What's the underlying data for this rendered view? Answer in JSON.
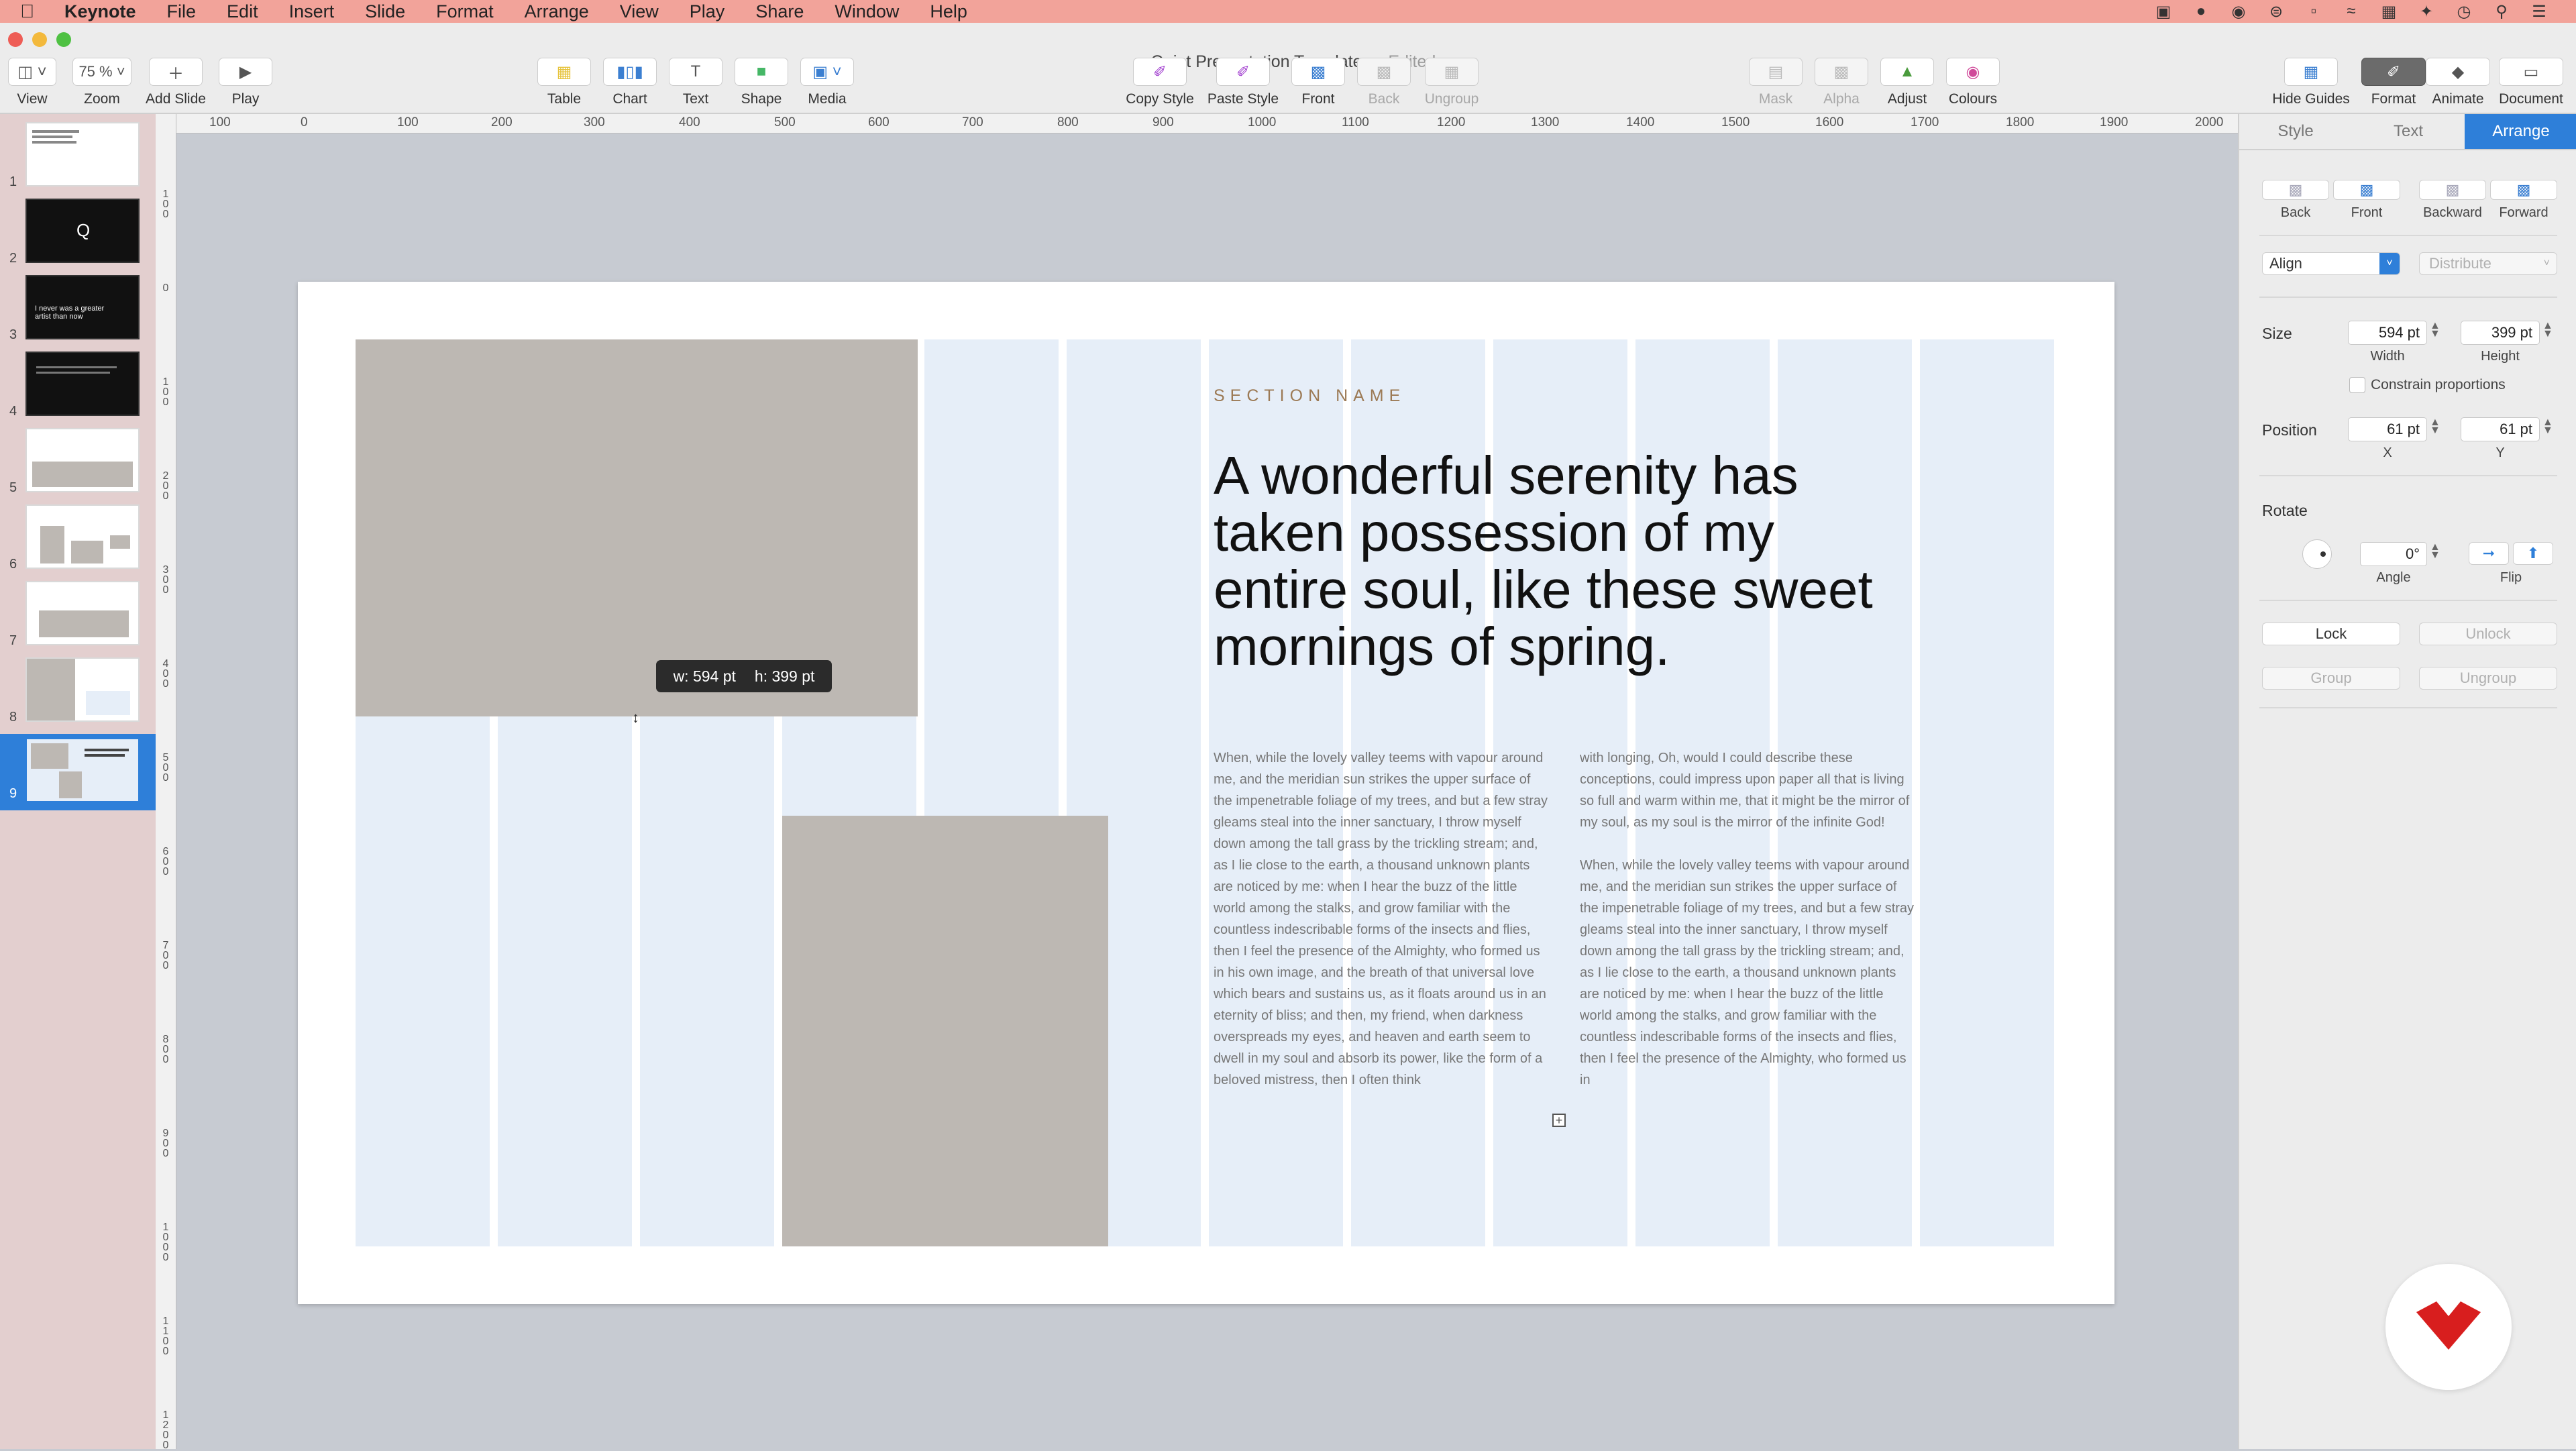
{
  "menubar": {
    "app_name": "Keynote",
    "items": [
      "File",
      "Edit",
      "Insert",
      "Slide",
      "Format",
      "Arrange",
      "View",
      "Play",
      "Share",
      "Window",
      "Help"
    ]
  },
  "window": {
    "title": "Quiet Presentation Template",
    "status": "— Edited"
  },
  "toolbar": {
    "view_label": "View",
    "zoom_value": "75 %",
    "zoom_label": "Zoom",
    "add_slide_label": "Add Slide",
    "play_label": "Play",
    "table_label": "Table",
    "chart_label": "Chart",
    "text_label": "Text",
    "shape_label": "Shape",
    "media_label": "Media",
    "copy_style_label": "Copy Style",
    "paste_style_label": "Paste Style",
    "front_label": "Front",
    "back_label": "Back",
    "ungroup_label": "Ungroup",
    "mask_label": "Mask",
    "alpha_label": "Alpha",
    "adjust_label": "Adjust",
    "colours_label": "Colours",
    "hide_guides_label": "Hide Guides",
    "format_label": "Format",
    "animate_label": "Animate",
    "document_label": "Document"
  },
  "navigator": {
    "slide_numbers": [
      "1",
      "2",
      "3",
      "4",
      "5",
      "6",
      "7",
      "8",
      "9"
    ],
    "selected_slide": "9",
    "slide3_text": "I never was a greater artist than now"
  },
  "ruler": {
    "top_ticks": [
      "100",
      "0",
      "100",
      "200",
      "300",
      "400",
      "500",
      "600",
      "700",
      "800",
      "900",
      "1000",
      "1100",
      "1200",
      "1300",
      "1400",
      "1500",
      "1600",
      "1700",
      "1800",
      "1900",
      "2000"
    ],
    "left_ticks": [
      "100",
      "0",
      "100",
      "200",
      "300",
      "400",
      "500",
      "600",
      "700",
      "800",
      "900",
      "1000",
      "1100",
      "1200"
    ]
  },
  "slide": {
    "section_name": "SECTION NAME",
    "headline": "A wonderful serenity has taken possession of my entire soul, like these sweet mornings of spring.",
    "body_col1": "When, while the lovely valley teems with vapour around me, and the meridian sun strikes the upper surface of the impenetrable foliage of my trees, and but a few stray gleams steal into the inner sanctuary, I throw myself down among the tall grass by the trickling stream; and, as I lie close to the earth, a thousand unknown plants are noticed by me: when I hear the buzz of the little world among the stalks, and grow familiar with the countless indescribable forms of the insects and flies, then I feel the presence of the Almighty, who formed us in his own image, and the breath of that universal love which bears and sustains us, as it floats around us in an eternity of bliss; and then, my friend, when darkness overspreads my eyes, and heaven and earth seem to dwell in my soul and absorb its power, like the form of a beloved mistress, then I often think",
    "body_col2_p1": "with longing, Oh, would I could describe these conceptions, could impress upon paper all that is living so full and warm within me, that it might be the mirror of my soul, as my soul is the mirror of the infinite God!",
    "body_col2_p2": "When, while the lovely valley teems with vapour around me, and the meridian sun strikes the upper surface of the impenetrable foliage of my trees, and but a few stray gleams steal into the inner sanctuary, I throw myself down among the tall grass by the trickling stream; and, as I lie close to the earth, a thousand unknown plants are noticed by me: when I hear the buzz of the little world among the stalks, and grow familiar with the countless indescribable forms of the insects and flies, then I feel the presence of the Almighty, who formed us in",
    "tooltip_w": "w: 594 pt",
    "tooltip_h": "h: 399 pt"
  },
  "inspector": {
    "tabs": [
      "Style",
      "Text",
      "Arrange"
    ],
    "active_tab": "Arrange",
    "back_label": "Back",
    "front_label": "Front",
    "backward_label": "Backward",
    "forward_label": "Forward",
    "align_value": "Align",
    "distribute_value": "Distribute",
    "size_label": "Size",
    "width_value": "594 pt",
    "width_label": "Width",
    "height_value": "399 pt",
    "height_label": "Height",
    "constrain_label": "Constrain proportions",
    "position_label": "Position",
    "x_value": "61 pt",
    "x_label": "X",
    "y_value": "61 pt",
    "y_label": "Y",
    "rotate_label": "Rotate",
    "angle_value": "0°",
    "angle_label": "Angle",
    "flip_label": "Flip",
    "lock_label": "Lock",
    "unlock_label": "Unlock",
    "group_label": "Group",
    "ungroup_label": "Ungroup"
  },
  "colors": {
    "menubar_bg": "#f2a39a",
    "accent_blue": "#2e7fd9",
    "guide_blue": "#e6eef8",
    "placeholder_gray": "#bdb8b3",
    "section_name_color": "#9c7a55",
    "logo_red": "#d81e1e"
  },
  "icons": [
    "apple-icon",
    "view-icon",
    "plus-icon",
    "play-icon",
    "table-icon",
    "chart-icon",
    "text-icon",
    "shape-icon",
    "media-icon",
    "copy-style-icon",
    "paste-style-icon",
    "front-icon",
    "back-icon",
    "ungroup-icon",
    "mask-icon",
    "alpha-icon",
    "adjust-icon",
    "colours-icon",
    "hide-guides-icon",
    "format-icon",
    "animate-icon",
    "document-icon",
    "wifi-icon",
    "search-icon",
    "clock-icon",
    "flip-horizontal-icon",
    "flip-vertical-icon",
    "rotate-dial-icon",
    "logo-icon"
  ]
}
